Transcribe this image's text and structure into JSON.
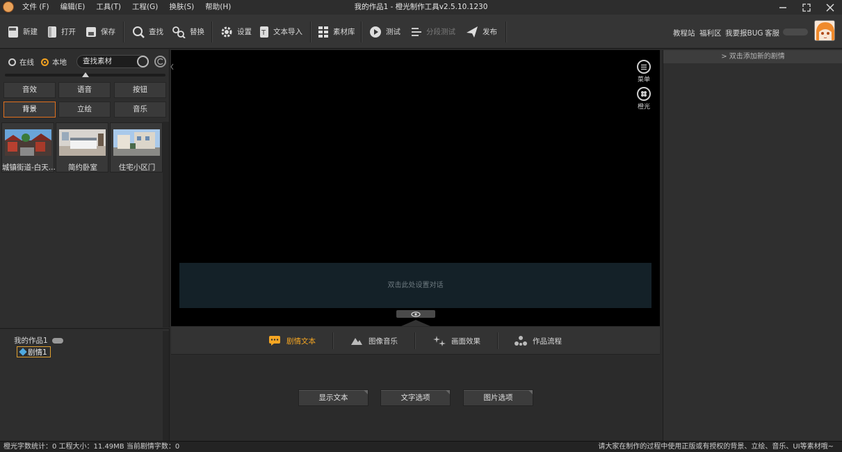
{
  "window": {
    "title": "我的作品1 - 橙光制作工具v2.5.10.1230",
    "menu": [
      "文件 (F)",
      "编辑(E)",
      "工具(T)",
      "工程(G)",
      "换肤(S)",
      "帮助(H)"
    ]
  },
  "toolbar": {
    "new_label": "新建",
    "open_label": "打开",
    "save_label": "保存",
    "find_label": "查找",
    "replace_label": "替换",
    "settings_label": "设置",
    "import_label": "文本导入",
    "library_label": "素材库",
    "test_label": "测试",
    "segment_test_label": "分段测试",
    "publish_label": "发布",
    "links": [
      "教程站",
      "福利区",
      "我要报BUG",
      "客服"
    ]
  },
  "asset_panel": {
    "radio_online": "在线",
    "radio_local": "本地",
    "selected_source": "本地",
    "search_placeholder": "查找素材",
    "categories": [
      "音效",
      "语音",
      "按钮",
      "背景",
      "立绘",
      "音乐"
    ],
    "active_category": "背景",
    "assets": [
      {
        "name": "城镇街道-白天..."
      },
      {
        "name": "简约卧室"
      },
      {
        "name": "住宅小区门"
      }
    ]
  },
  "project_tree": {
    "root": "我的作品1",
    "selected_node": "剧情1"
  },
  "stage": {
    "menu_icon_label": "菜单",
    "brand_icon_label": "橙光",
    "dialog_hint": "双击此处设置对话"
  },
  "editor": {
    "tabs": [
      "剧情文本",
      "图像音乐",
      "画面效果",
      "作品流程"
    ],
    "active_tab": "剧情文本",
    "buttons": [
      "显示文本",
      "文字选项",
      "图片选项"
    ]
  },
  "right_panel": {
    "header": "> 双击添加新的剧情"
  },
  "statusbar": {
    "left": "橙光字数统计：0  工程大小：11.49MB  当前剧情字数：0",
    "right": "请大家在制作的过程中使用正版或有授权的背景、立绘、音乐、UI等素材哦~"
  },
  "colors": {
    "accent": "#f5a623",
    "selection_border": "#e0701e",
    "background": "#2b2b2b"
  }
}
